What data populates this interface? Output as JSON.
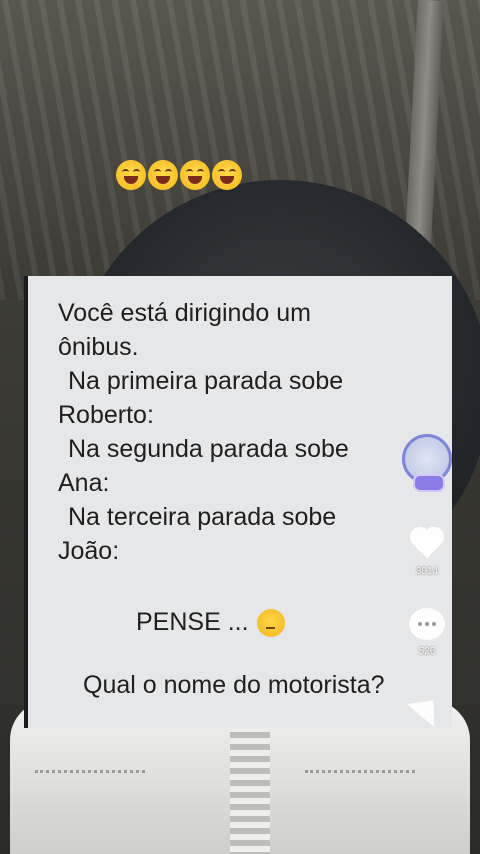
{
  "post": {
    "emoji_overlay": [
      "grinning-squinting-face",
      "grinning-squinting-face",
      "grinning-squinting-face",
      "grinning-squinting-face"
    ],
    "lines": [
      "Você está dirigindo um",
      "ônibus.",
      " Na primeira parada sobe",
      "Roberto:",
      " Na segunda parada sobe",
      "Ana:",
      " Na terceira parada sobe",
      "João:"
    ],
    "pense": "PENSE ...",
    "pense_emoji": "thinking-face",
    "question": "Qual o nome do motorista?"
  },
  "rail": {
    "like_count": "3014",
    "comment_count": "526"
  },
  "colors": {
    "card_bg": "#e6e7e9",
    "text": "#1f1f1f",
    "avatar_ring": "#7b86d8"
  }
}
